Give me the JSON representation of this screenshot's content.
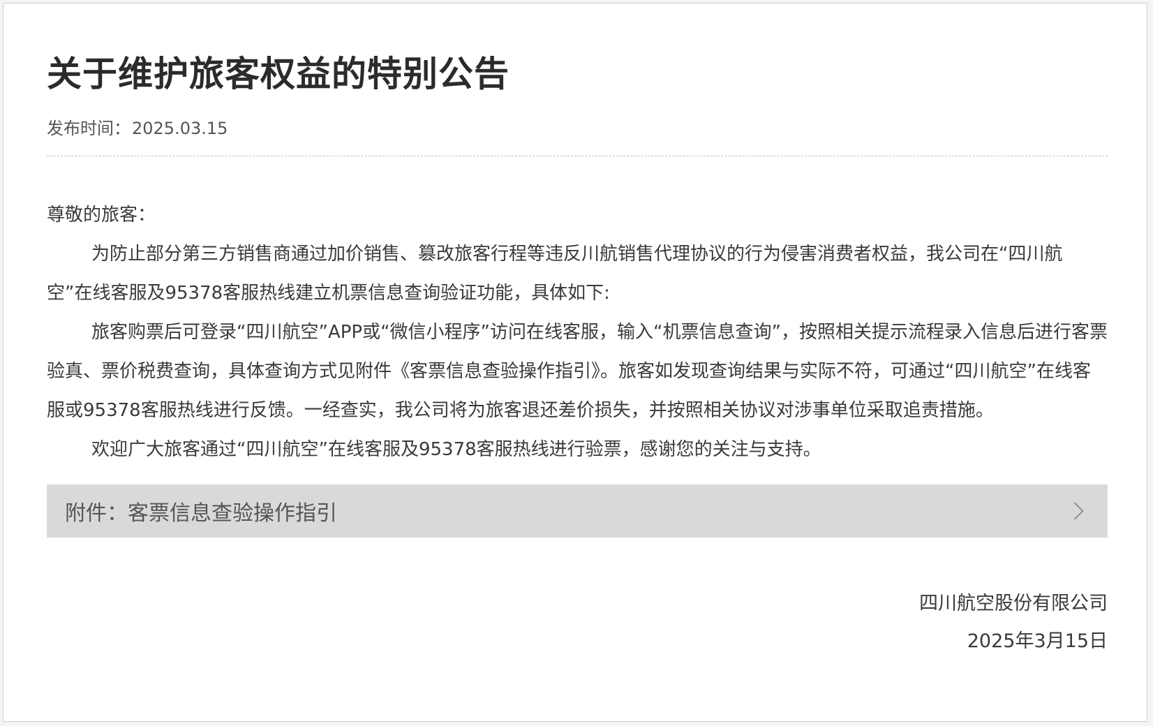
{
  "notice": {
    "title": "关于维护旅客权益的特别公告",
    "publish_label": "发布时间：",
    "publish_date": "2025.03.15",
    "greeting": "尊敬的旅客：",
    "paragraphs": [
      "为防止部分第三方销售商通过加价销售、篡改旅客行程等违反川航销售代理协议的行为侵害消费者权益，我公司在“四川航空”在线客服及95378客服热线建立机票信息查询验证功能，具体如下:",
      "旅客购票后可登录“四川航空”APP或“微信小程序”访问在线客服，输入“机票信息查询”，按照相关提示流程录入信息后进行客票验真、票价税费查询，具体查询方式见附件《客票信息查验操作指引》。旅客如发现查询结果与实际不符，可通过“四川航空”在线客服或95378客服热线进行反馈。一经查实，我公司将为旅客退还差价损失，并按照相关协议对涉事单位采取追责措施。",
      "欢迎广大旅客通过“四川航空”在线客服及95378客服热线进行验票，感谢您的关注与支持。"
    ],
    "attachment_label": "附件：客票信息查验操作指引",
    "signature_company": "四川航空股份有限公司",
    "signature_date": "2025年3月15日"
  },
  "colors": {
    "attachment_bg": "#d9d9d9",
    "title_text": "#2b2b2b",
    "body_text": "#3a3a3a"
  },
  "icons": {
    "attachment_arrow": "chevron-right-icon"
  }
}
